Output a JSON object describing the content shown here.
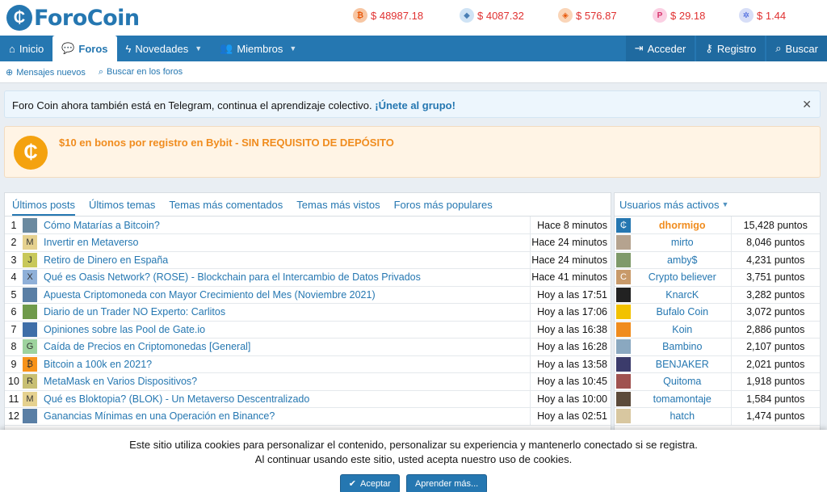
{
  "brand": {
    "name": "ForoCoin"
  },
  "prices": [
    {
      "symbol": "btc",
      "value": "$ 48987.18",
      "bg": "#f7c6a3",
      "fg": "#e8590c",
      "glyph": "₿"
    },
    {
      "symbol": "eth",
      "value": "$ 4087.32",
      "bg": "#cfe3f5",
      "fg": "#4a7fb5",
      "glyph": "◆"
    },
    {
      "symbol": "bnb",
      "value": "$ 576.87",
      "bg": "#fad5b8",
      "fg": "#e8590c",
      "glyph": "◈"
    },
    {
      "symbol": "dot",
      "value": "$ 29.18",
      "bg": "#fbd0e3",
      "fg": "#d6336c",
      "glyph": "P"
    },
    {
      "symbol": "atom",
      "value": "$ 1.44",
      "bg": "#d7def7",
      "fg": "#3b5bdb",
      "glyph": "✲"
    }
  ],
  "nav": {
    "items": [
      {
        "label": "Inicio",
        "icon": "home-icon"
      },
      {
        "label": "Foros",
        "icon": "chat-icon"
      },
      {
        "label": "Novedades",
        "icon": "bolt-icon"
      },
      {
        "label": "Miembros",
        "icon": "users-icon"
      }
    ],
    "login": "Acceder",
    "register": "Registro",
    "search": "Buscar"
  },
  "subnav": {
    "new_posts": "Mensajes nuevos",
    "search_forums": "Buscar en los foros"
  },
  "notice": {
    "text": "Foro Coin ahora también está en Telegram, continua el aprendizaje colectivo.",
    "link": "¡Únete al grupo!"
  },
  "promo": {
    "text": "$10 en bonos por registro en Bybit - SIN REQUISITO DE DEPÓSITO"
  },
  "tabs": [
    "Últimos posts",
    "Últimos temas",
    "Temas más comentados",
    "Temas más vistos",
    "Foros más populares"
  ],
  "posts": [
    {
      "n": "1",
      "title": "Cómo Matarías a Bitcoin?",
      "time": "Hace 8 minutos",
      "av": "",
      "avbg": "#6b8aa0"
    },
    {
      "n": "2",
      "title": "Invertir en Metaverso",
      "time": "Hace 24 minutos",
      "av": "M",
      "avbg": "#e5d18f"
    },
    {
      "n": "3",
      "title": "Retiro de Dinero en España",
      "time": "Hace 24 minutos",
      "av": "J",
      "avbg": "#c8c85a"
    },
    {
      "n": "4",
      "title": "Qué es Oasis Network? (ROSE) - Blockchain para el Intercambio de Datos Privados",
      "time": "Hace 41 minutos",
      "av": "X",
      "avbg": "#8fb0d8"
    },
    {
      "n": "5",
      "title": "Apuesta Criptomoneda con Mayor Crecimiento del Mes (Noviembre 2021)",
      "time": "Hoy a las 17:51",
      "av": "",
      "avbg": "#5a7fa5"
    },
    {
      "n": "6",
      "title": "Diario de un Trader NO Experto: Carlitos",
      "time": "Hoy a las 17:06",
      "av": "",
      "avbg": "#6f9a4a"
    },
    {
      "n": "7",
      "title": "Opiniones sobre las Pool de Gate.io",
      "time": "Hoy a las 16:38",
      "av": "",
      "avbg": "#3f6ea8"
    },
    {
      "n": "8",
      "title": "Caída de Precios en Criptomonedas [General]",
      "time": "Hoy a las 16:28",
      "av": "G",
      "avbg": "#9ed39e"
    },
    {
      "n": "9",
      "title": "Bitcoin a 100k en 2021?",
      "time": "Hoy a las 13:58",
      "av": "₿",
      "avbg": "#f7931a"
    },
    {
      "n": "10",
      "title": "MetaMask en Varios Dispositivos?",
      "time": "Hoy a las 10:45",
      "av": "R",
      "avbg": "#c8bf72"
    },
    {
      "n": "11",
      "title": "Qué es Bloktopia? (BLOK) - Un Metaverso Descentralizado",
      "time": "Hoy a las 10:00",
      "av": "M",
      "avbg": "#e5d18f"
    },
    {
      "n": "12",
      "title": "Ganancias Mínimas en una Operación en Binance?",
      "time": "Hoy a las 02:51",
      "av": "",
      "avbg": "#5a7fa5"
    }
  ],
  "users_panel": {
    "title": "Usuarios más activos"
  },
  "users": [
    {
      "name": "dhormigo",
      "points": "15,428 puntos",
      "av": "₵",
      "avbg": "#2577b1"
    },
    {
      "name": "mirto",
      "points": "8,046 puntos",
      "av": "",
      "avbg": "#b5a38f"
    },
    {
      "name": "amby$",
      "points": "4,231 puntos",
      "av": "",
      "avbg": "#7f9a6a"
    },
    {
      "name": "Crypto believer",
      "points": "3,751 puntos",
      "av": "C",
      "avbg": "#c89a6a"
    },
    {
      "name": "KnarcK",
      "points": "3,282 puntos",
      "av": "",
      "avbg": "#222222"
    },
    {
      "name": "Bufalo Coin",
      "points": "3,072 puntos",
      "av": "",
      "avbg": "#f2c200"
    },
    {
      "name": "Koin",
      "points": "2,886 puntos",
      "av": "",
      "avbg": "#f08c1e"
    },
    {
      "name": "Bambino",
      "points": "2,107 puntos",
      "av": "",
      "avbg": "#8aa8c0"
    },
    {
      "name": "BENJAKER",
      "points": "2,021 puntos",
      "av": "",
      "avbg": "#3b3b6b"
    },
    {
      "name": "Quitoma",
      "points": "1,918 puntos",
      "av": "",
      "avbg": "#a0524f"
    },
    {
      "name": "tomamontaje",
      "points": "1,584 puntos",
      "av": "",
      "avbg": "#5b4a3a"
    },
    {
      "name": "hatch",
      "points": "1,474 puntos",
      "av": "",
      "avbg": "#d8c7a0"
    }
  ],
  "cookie": {
    "line1": "Este sitio utiliza cookies para personalizar el contenido, personalizar su experiencia y mantenerlo conectado si se registra.",
    "line2": "Al continuar usando este sitio, usted acepta nuestro uso de cookies.",
    "accept": "Aceptar",
    "learn_more": "Aprender más..."
  }
}
